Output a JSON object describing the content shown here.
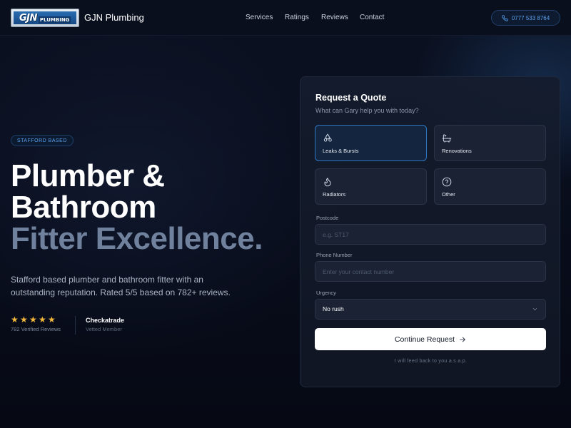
{
  "header": {
    "logo_text_main": "GJN",
    "logo_text_sub": "PLUMBING",
    "brand_name": "GJN Plumbing",
    "nav": [
      {
        "label": "Services"
      },
      {
        "label": "Ratings"
      },
      {
        "label": "Reviews"
      },
      {
        "label": "Contact"
      }
    ],
    "phone": "0777 533 8764"
  },
  "hero": {
    "badge": "STAFFORD BASED",
    "headline_line1": "Plumber &",
    "headline_line2": "Bathroom",
    "headline_line3": "Fitter Excellence.",
    "lede": "Stafford based plumber and bathroom fitter with an outstanding reputation. Rated 5/5 based on 782+ reviews.",
    "rating_stars": 5,
    "verified_reviews": "782 Verified Reviews",
    "checkatrade_title": "Checkatrade",
    "checkatrade_sub": "Vetted Member"
  },
  "quote": {
    "title": "Request a Quote",
    "subtitle": "What can Gary help you with today?",
    "options": [
      {
        "label": "Leaks & Bursts",
        "icon": "droplets-icon",
        "selected": true
      },
      {
        "label": "Renovations",
        "icon": "bath-icon",
        "selected": false
      },
      {
        "label": "Radiators",
        "icon": "flame-icon",
        "selected": false
      },
      {
        "label": "Other",
        "icon": "question-circle-icon",
        "selected": false
      }
    ],
    "postcode_label": "Postcode",
    "postcode_placeholder": "e.g. ST17",
    "phone_label": "Phone Number",
    "phone_placeholder": "Enter your contact number",
    "urgency_label": "Urgency",
    "urgency_value": "No rush",
    "cta_label": "Continue Request",
    "footnote": "I will feed back to you a.s.a.p."
  },
  "colors": {
    "background": "#070b18",
    "accent": "#5aa3f0",
    "star": "#f4b73c",
    "selected_border": "#2f76c4"
  }
}
